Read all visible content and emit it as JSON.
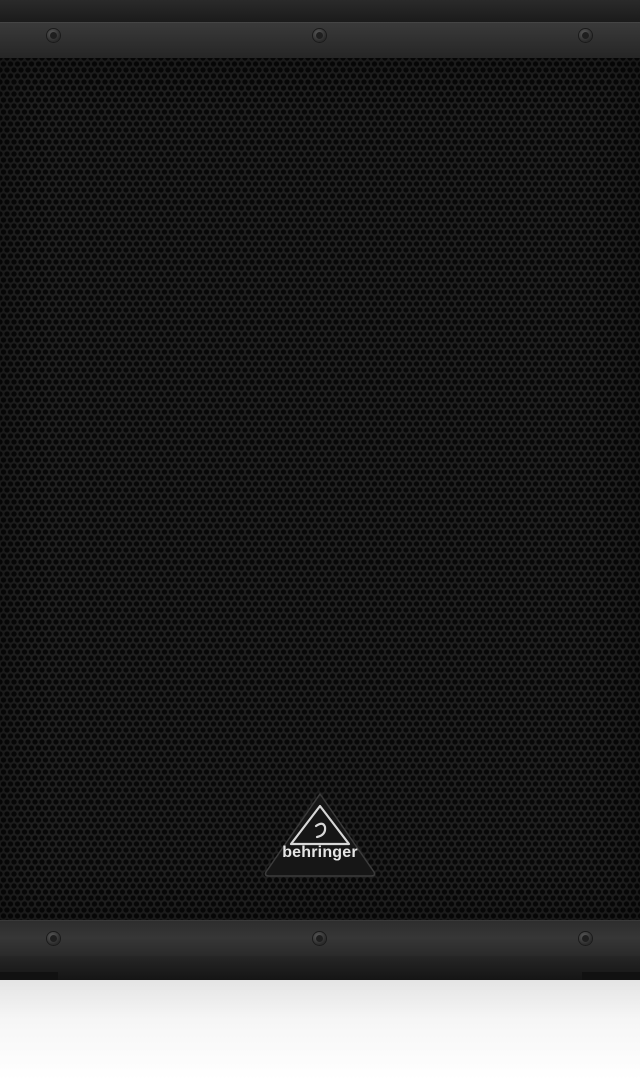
{
  "product": {
    "brand_logo_text": "behringer",
    "cabinet_color": "#1c1c1c",
    "grille_color": "#202020",
    "screws": {
      "top_count": 3,
      "bottom_count": 3
    }
  }
}
